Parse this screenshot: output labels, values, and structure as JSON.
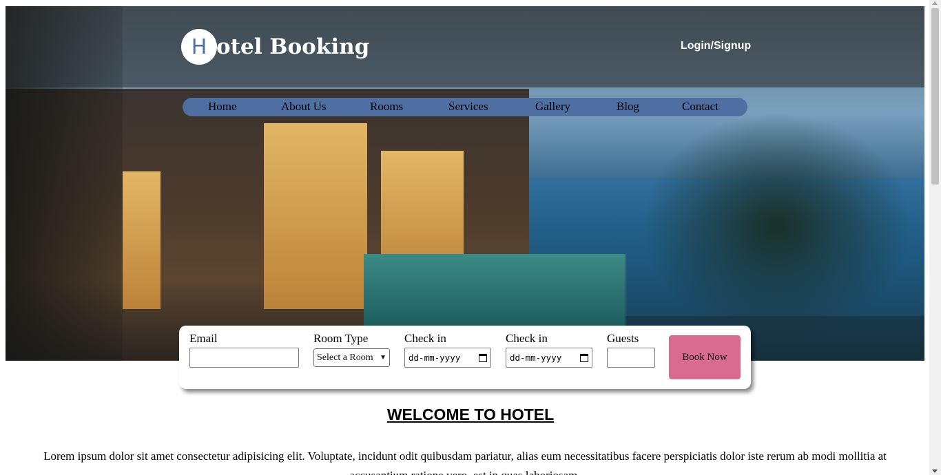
{
  "header": {
    "logo_letter": "H",
    "logo_text": "otel Booking",
    "login_label": "Login/Signup"
  },
  "nav": {
    "items": [
      "Home",
      "About Us",
      "Rooms",
      "Services",
      "Gallery",
      "Blog",
      "Contact"
    ]
  },
  "booking": {
    "email_label": "Email",
    "email_value": "",
    "room_type_label": "Room Type",
    "room_type_selected": "Select a Room",
    "checkin_label": "Check in",
    "checkin_placeholder": "dd-mm-yyyy",
    "checkout_label": "Check in",
    "checkout_placeholder": "dd-mm-yyyy",
    "guests_label": "Guests",
    "guests_value": "",
    "book_button": "Book Now"
  },
  "content": {
    "welcome_title": "WELCOME TO HOTEL",
    "intro_text": "Lorem ipsum dolor sit amet consectetur adipisicing elit. Voluptate, incidunt odit quibusdam pariatur, alias eum necessitatibus facere perspiciatis dolor iste rerum ab modi mollitia at accusantium ratione vero, est in quas laboriosam."
  },
  "colors": {
    "nav_bg": "#4f6fa3",
    "book_button_bg": "#d86b8f",
    "logo_letter": "#4f6fa3"
  },
  "icons": {
    "calendar": "calendar-icon",
    "dropdown": "chevron-down-icon"
  }
}
